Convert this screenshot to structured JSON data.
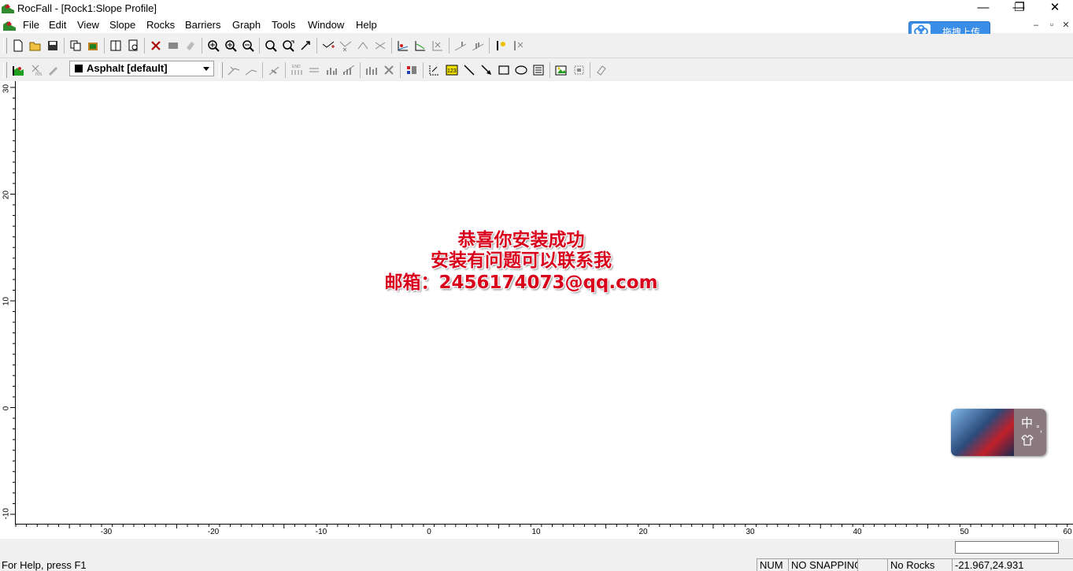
{
  "window": {
    "title": "RocFall - [Rock1:Slope Profile]",
    "controls": {
      "minimize": "—",
      "restore": "❐",
      "close": "✕"
    }
  },
  "menu": {
    "items": [
      "File",
      "Edit",
      "View",
      "Slope",
      "Rocks",
      "Barriers",
      "Graph",
      "Tools",
      "Window",
      "Help"
    ],
    "mdi_controls": {
      "minimize": "–",
      "restore": "▫",
      "close": "✕"
    }
  },
  "upload_widget": {
    "label": "拖拽上传"
  },
  "toolbar2": {
    "material": {
      "selected": "Asphalt [default]",
      "swatch_color": "#000000"
    }
  },
  "axes": {
    "y_ticks": [
      "30",
      "20",
      "10",
      "0",
      "-10"
    ],
    "x_ticks": [
      "-30",
      "-20",
      "-10",
      "0",
      "10",
      "20",
      "30",
      "40",
      "50",
      "60"
    ]
  },
  "watermark": {
    "line1": "恭喜你安装成功",
    "line2": "安装有问题可以联系我",
    "line3": "邮箱：2456174073@qq.com",
    "color": "#d9001b"
  },
  "ime_widget": {
    "lang": "中",
    "punct": "°,",
    "skin_icon": "shirt-icon"
  },
  "statusbar": {
    "help": "For Help, press F1",
    "num": "NUM",
    "snapping": "NO SNAPPING",
    "empty": "",
    "rocks": "No Rocks",
    "coords": "-21.967,24.931"
  }
}
